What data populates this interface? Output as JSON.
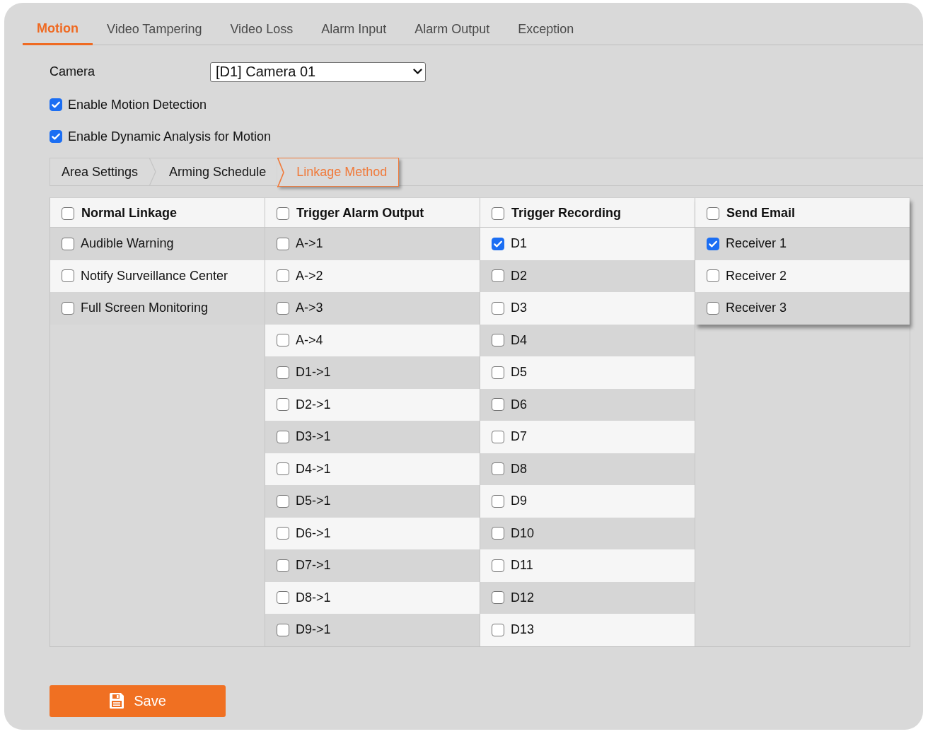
{
  "tabs": [
    {
      "label": "Motion",
      "selected": true
    },
    {
      "label": "Video Tampering",
      "selected": false
    },
    {
      "label": "Video Loss",
      "selected": false
    },
    {
      "label": "Alarm Input",
      "selected": false
    },
    {
      "label": "Alarm Output",
      "selected": false
    },
    {
      "label": "Exception",
      "selected": false
    }
  ],
  "camera": {
    "label": "Camera",
    "value": "[D1] Camera 01"
  },
  "options": [
    {
      "label": "Enable Motion Detection",
      "checked": true
    },
    {
      "label": "Enable Dynamic Analysis for Motion",
      "checked": true
    }
  ],
  "sub_tabs": [
    {
      "label": "Area Settings",
      "selected": false
    },
    {
      "label": "Arming Schedule",
      "selected": false
    },
    {
      "label": "Linkage Method",
      "selected": true
    }
  ],
  "linkage_columns": [
    {
      "title": "Normal Linkage",
      "checked": false,
      "raised": false,
      "first_row_shaded": true,
      "items": [
        {
          "label": "Audible Warning",
          "checked": false
        },
        {
          "label": "Notify Surveillance Center",
          "checked": false
        },
        {
          "label": "Full Screen Monitoring",
          "checked": false
        }
      ]
    },
    {
      "title": "Trigger Alarm Output",
      "checked": false,
      "raised": false,
      "first_row_shaded": true,
      "items": [
        {
          "label": "A->1",
          "checked": false
        },
        {
          "label": "A->2",
          "checked": false
        },
        {
          "label": "A->3",
          "checked": false
        },
        {
          "label": "A->4",
          "checked": false
        },
        {
          "label": "D1->1",
          "checked": false
        },
        {
          "label": "D2->1",
          "checked": false
        },
        {
          "label": "D3->1",
          "checked": false
        },
        {
          "label": "D4->1",
          "checked": false
        },
        {
          "label": "D5->1",
          "checked": false
        },
        {
          "label": "D6->1",
          "checked": false
        },
        {
          "label": "D7->1",
          "checked": false
        },
        {
          "label": "D8->1",
          "checked": false
        },
        {
          "label": "D9->1",
          "checked": false
        }
      ]
    },
    {
      "title": "Trigger Recording",
      "checked": false,
      "raised": false,
      "first_row_shaded": false,
      "items": [
        {
          "label": "D1",
          "checked": true
        },
        {
          "label": "D2",
          "checked": false
        },
        {
          "label": "D3",
          "checked": false
        },
        {
          "label": "D4",
          "checked": false
        },
        {
          "label": "D5",
          "checked": false
        },
        {
          "label": "D6",
          "checked": false
        },
        {
          "label": "D7",
          "checked": false
        },
        {
          "label": "D8",
          "checked": false
        },
        {
          "label": "D9",
          "checked": false
        },
        {
          "label": "D10",
          "checked": false
        },
        {
          "label": "D11",
          "checked": false
        },
        {
          "label": "D12",
          "checked": false
        },
        {
          "label": "D13",
          "checked": false
        }
      ]
    },
    {
      "title": "Send Email",
      "checked": false,
      "raised": true,
      "first_row_shaded": true,
      "items": [
        {
          "label": "Receiver 1",
          "checked": true
        },
        {
          "label": "Receiver 2",
          "checked": false
        },
        {
          "label": "Receiver 3",
          "checked": false
        }
      ]
    }
  ],
  "save_button": {
    "label": "Save"
  }
}
